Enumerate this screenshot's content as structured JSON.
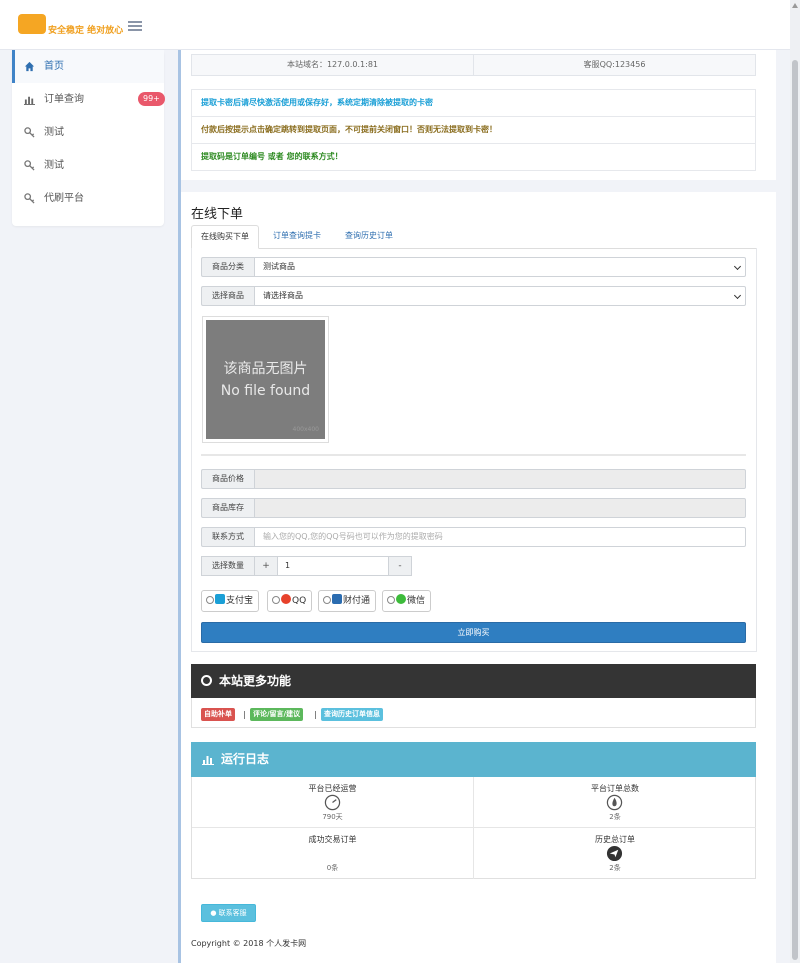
{
  "header": {
    "logo_text": "安全稳定 绝对放心",
    "colors": {
      "accent": "#3f83c7",
      "logo": "#f5a623"
    }
  },
  "sidebar": {
    "items": [
      {
        "label": "首页",
        "icon": "home-icon"
      },
      {
        "label": "订单查询",
        "icon": "bar-chart-icon",
        "badge": "99+"
      },
      {
        "label": "测试",
        "icon": "key-icon"
      },
      {
        "label": "测试",
        "icon": "key-icon"
      },
      {
        "label": "代刷平台",
        "icon": "key-icon"
      }
    ]
  },
  "info": {
    "domain": "本站域名：127.0.0.1:81",
    "service_qq": "客服QQ:123456"
  },
  "notices": [
    {
      "text": "提取卡密后请尽快激活使用或保存好，系统定期清除被提取的卡密",
      "color": "#1a9fd6"
    },
    {
      "text": "付款后按提示点击确定跳转到提取页面，不可提前关闭窗口！否则无法提取到卡密！",
      "color": "#8a6d1e"
    },
    {
      "text": "提取码是订单编号 或者 您的联系方式！",
      "color": "#2e8b22"
    }
  ],
  "order": {
    "title": "在线下单",
    "tabs": [
      "在线购买下单",
      "订单查询提卡",
      "查询历史订单"
    ],
    "fields": {
      "category_label": "商品分类",
      "category_value": "测试商品",
      "product_label": "选择商品",
      "product_value": "请选择商品",
      "price_label": "商品价格",
      "price_value": "",
      "stock_label": "商品库存",
      "stock_value": "",
      "contact_label": "联系方式",
      "contact_placeholder": "输入您的QQ,您的QQ号码也可以作为您的提取密码",
      "qty_label": "选择数量",
      "qty_plus": "+",
      "qty_value": "1",
      "qty_minus": "-"
    },
    "image": {
      "line1": "该商品无图片",
      "line2": "No file found",
      "small": "400x400"
    },
    "payments": [
      {
        "label": "支付宝",
        "icon_color": "#1a9fd6",
        "icon": "alipay-icon"
      },
      {
        "label": "QQ",
        "icon_color": "#e7412b",
        "icon": "qq-icon"
      },
      {
        "label": "财付通",
        "icon_color": "#2b6cb0",
        "icon": "tenpay-icon"
      },
      {
        "label": "微信",
        "icon_color": "#3dbb3b",
        "icon": "wechat-icon"
      }
    ],
    "buy_label": "立即购买"
  },
  "more": {
    "title": "本站更多功能",
    "links": [
      {
        "label": "自助补单",
        "color": "#d9534f"
      },
      {
        "label": "评论/留言/建议",
        "color": "#5cb85c"
      },
      {
        "label": "查询历史订单信息",
        "color": "#5bc0de"
      }
    ],
    "separator": "|"
  },
  "log": {
    "title": "运行日志",
    "cells": [
      {
        "title": "平台已经运营",
        "value": "790天",
        "icon": "gauge-icon"
      },
      {
        "title": "平台订单总数",
        "value": "2条",
        "icon": "fire-icon"
      },
      {
        "title": "成功交易订单",
        "value": "0条",
        "icon": ""
      },
      {
        "title": "历史总订单",
        "value": "2条",
        "icon": "send-icon"
      }
    ]
  },
  "contact_button": "联系客服",
  "footer": "Copyright © 2018 个人发卡网"
}
